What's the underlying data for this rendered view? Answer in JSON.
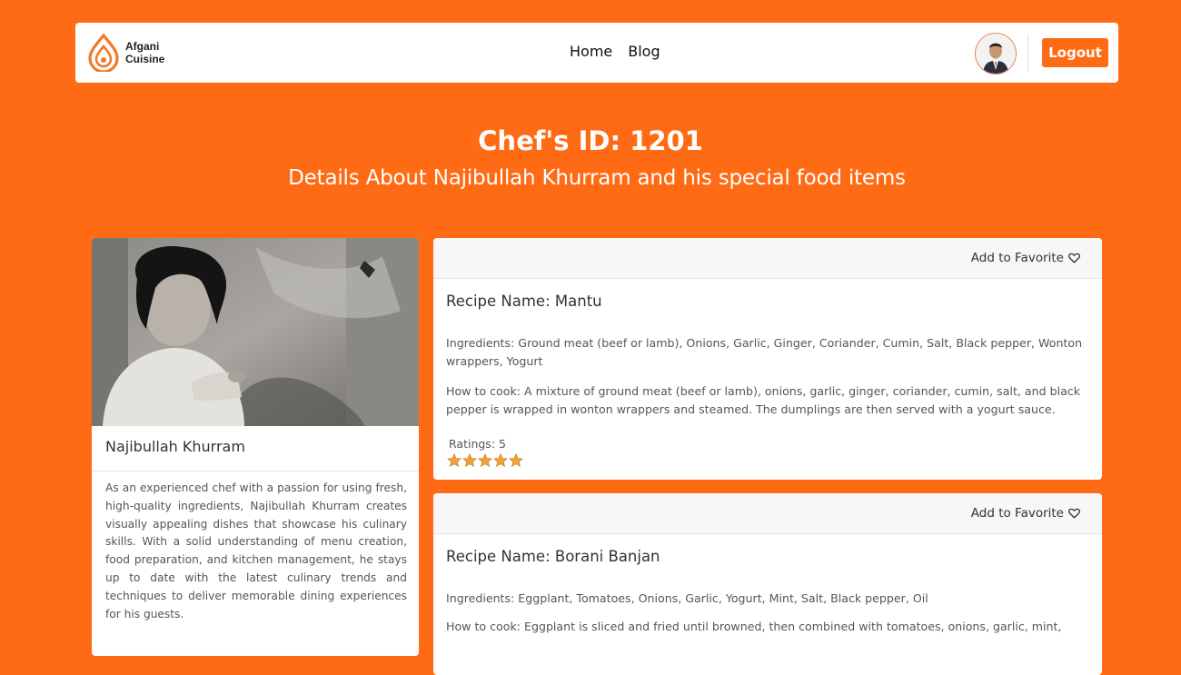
{
  "brand": {
    "line1": "Afgani",
    "line2": "Cuisine"
  },
  "nav": {
    "links": [
      "Home",
      "Blog"
    ],
    "logout_label": "Logout"
  },
  "colors": {
    "accent": "#FF6A14",
    "star": "#F0A23A"
  },
  "header": {
    "title": "Chef's ID: 1201",
    "subtitle": "Details About Najibullah Khurram and his special food items"
  },
  "chef": {
    "name": "Najibullah Khurram",
    "bio": "As an experienced chef with a passion for using fresh, high-quality ingredients, Najibullah Khurram creates visually appealing dishes that showcase his culinary skills. With a solid understanding of menu creation, food preparation, and kitchen management, he stays up to date with the latest culinary trends and techniques to deliver memorable dining experiences for his guests."
  },
  "recipes": [
    {
      "favorite_label": "Add to Favorite",
      "name": "Recipe Name: Mantu",
      "ingredients": "Ingredients: Ground meat (beef or lamb), Onions, Garlic, Ginger, Coriander, Cumin, Salt, Black pepper, Wonton wrappers, Yogurt",
      "how_to_cook": "How to cook: A mixture of ground meat (beef or lamb), onions, garlic, ginger, coriander, cumin, salt, and black pepper is wrapped in wonton wrappers and steamed. The dumplings are then served with a yogurt sauce.",
      "ratings_label": "Ratings: 5",
      "rating": 5
    },
    {
      "favorite_label": "Add to Favorite",
      "name": "Recipe Name: Borani Banjan",
      "ingredients": "Ingredients: Eggplant, Tomatoes, Onions, Garlic, Yogurt, Mint, Salt, Black pepper, Oil",
      "how_to_cook": "How to cook: Eggplant is sliced and fried until browned, then combined with tomatoes, onions, garlic, mint,"
    }
  ]
}
